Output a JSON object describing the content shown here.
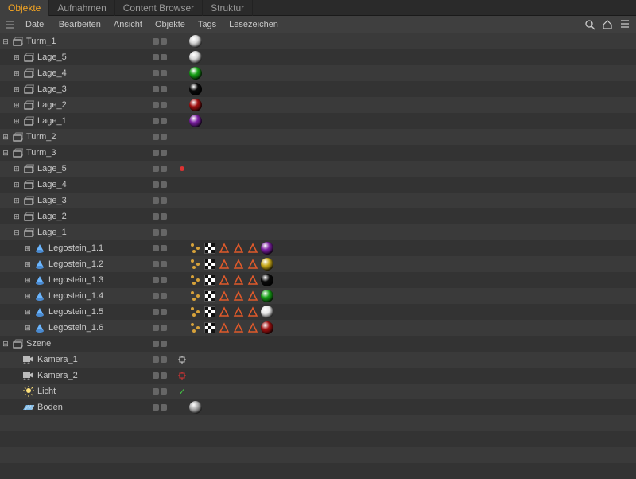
{
  "tabs": {
    "items": [
      "Objekte",
      "Aufnahmen",
      "Content Browser",
      "Struktur"
    ],
    "active": 0
  },
  "menu": {
    "items": [
      "Datei",
      "Bearbeiten",
      "Ansicht",
      "Objekte",
      "Tags",
      "Lesezeichen"
    ]
  },
  "icons": {
    "hamburger": "hamburger-icon",
    "search": "search-icon",
    "home": "home-icon",
    "menu": "menu-icon"
  },
  "tree": [
    {
      "d": 0,
      "exp": "-",
      "ic": "null",
      "label": "Turm_1",
      "dot": "",
      "tags": [
        {
          "t": "sphere",
          "c": "#d8d8d8"
        }
      ]
    },
    {
      "d": 1,
      "exp": "+",
      "ic": "null",
      "label": "Lage_5",
      "dot": "",
      "tags": [
        {
          "t": "sphere",
          "c": "#d8d8d8"
        }
      ]
    },
    {
      "d": 1,
      "exp": "+",
      "ic": "null",
      "label": "Lage_4",
      "dot": "",
      "tags": [
        {
          "t": "sphere",
          "c": "#16a016"
        }
      ]
    },
    {
      "d": 1,
      "exp": "+",
      "ic": "null",
      "label": "Lage_3",
      "dot": "",
      "tags": [
        {
          "t": "sphere",
          "c": "#0a0a0a"
        }
      ]
    },
    {
      "d": 1,
      "exp": "+",
      "ic": "null",
      "label": "Lage_2",
      "dot": "",
      "tags": [
        {
          "t": "sphere",
          "c": "#a01010"
        }
      ]
    },
    {
      "d": 1,
      "exp": "+",
      "ic": "null",
      "label": "Lage_1",
      "dot": "",
      "tags": [
        {
          "t": "sphere",
          "c": "#7a1fa0"
        }
      ]
    },
    {
      "d": 0,
      "exp": "+",
      "ic": "null",
      "label": "Turm_2",
      "dot": "",
      "tags": []
    },
    {
      "d": 0,
      "exp": "-",
      "ic": "null",
      "label": "Turm_3",
      "dot": "",
      "tags": []
    },
    {
      "d": 1,
      "exp": "+",
      "ic": "null",
      "label": "Lage_5",
      "dot": "red",
      "tags": []
    },
    {
      "d": 1,
      "exp": "+",
      "ic": "null",
      "label": "Lage_4",
      "dot": "",
      "tags": []
    },
    {
      "d": 1,
      "exp": "+",
      "ic": "null",
      "label": "Lage_3",
      "dot": "",
      "tags": []
    },
    {
      "d": 1,
      "exp": "+",
      "ic": "null",
      "label": "Lage_2",
      "dot": "",
      "tags": []
    },
    {
      "d": 1,
      "exp": "-",
      "ic": "null",
      "label": "Lage_1",
      "dot": "",
      "tags": []
    },
    {
      "d": 2,
      "exp": "+",
      "ic": "cone",
      "label": "Legostein_1.1",
      "dot": "",
      "tags": [
        {
          "t": "dots"
        },
        {
          "t": "check"
        },
        {
          "t": "tri"
        },
        {
          "t": "tri"
        },
        {
          "t": "tri"
        },
        {
          "t": "sphere",
          "c": "#7a1fa0"
        }
      ]
    },
    {
      "d": 2,
      "exp": "+",
      "ic": "cone",
      "label": "Legostein_1.2",
      "dot": "",
      "tags": [
        {
          "t": "dots"
        },
        {
          "t": "check"
        },
        {
          "t": "tri"
        },
        {
          "t": "tri"
        },
        {
          "t": "tri"
        },
        {
          "t": "sphere",
          "c": "#c7a818"
        }
      ]
    },
    {
      "d": 2,
      "exp": "+",
      "ic": "cone",
      "label": "Legostein_1.3",
      "dot": "",
      "tags": [
        {
          "t": "dots"
        },
        {
          "t": "check"
        },
        {
          "t": "tri"
        },
        {
          "t": "tri"
        },
        {
          "t": "tri"
        },
        {
          "t": "sphere",
          "c": "#0a0a0a"
        }
      ]
    },
    {
      "d": 2,
      "exp": "+",
      "ic": "cone",
      "label": "Legostein_1.4",
      "dot": "",
      "tags": [
        {
          "t": "dots"
        },
        {
          "t": "check"
        },
        {
          "t": "tri"
        },
        {
          "t": "tri"
        },
        {
          "t": "tri"
        },
        {
          "t": "sphere",
          "c": "#16a016"
        }
      ]
    },
    {
      "d": 2,
      "exp": "+",
      "ic": "cone",
      "label": "Legostein_1.5",
      "dot": "",
      "tags": [
        {
          "t": "dots"
        },
        {
          "t": "check"
        },
        {
          "t": "tri"
        },
        {
          "t": "tri"
        },
        {
          "t": "tri"
        },
        {
          "t": "sphere",
          "c": "#e8e8e8"
        }
      ]
    },
    {
      "d": 2,
      "exp": "+",
      "ic": "cone",
      "label": "Legostein_1.6",
      "dot": "",
      "tags": [
        {
          "t": "dots"
        },
        {
          "t": "check"
        },
        {
          "t": "tri"
        },
        {
          "t": "tri"
        },
        {
          "t": "tri"
        },
        {
          "t": "sphere",
          "c": "#a01010"
        }
      ]
    },
    {
      "d": 0,
      "exp": "-",
      "ic": "null",
      "label": "Szene",
      "dot": "",
      "tags": []
    },
    {
      "d": 1,
      "exp": "",
      "ic": "camera",
      "label": "Kamera_1",
      "dot": "cross",
      "tags": []
    },
    {
      "d": 1,
      "exp": "",
      "ic": "camera",
      "label": "Kamera_2",
      "dot": "cross-red",
      "tags": []
    },
    {
      "d": 1,
      "exp": "",
      "ic": "light",
      "label": "Licht",
      "dot": "checkmark",
      "tags": []
    },
    {
      "d": 1,
      "exp": "",
      "ic": "floor",
      "label": "Boden",
      "dot": "",
      "tags": [
        {
          "t": "sphere",
          "c": "#b0b0b0"
        }
      ]
    }
  ]
}
